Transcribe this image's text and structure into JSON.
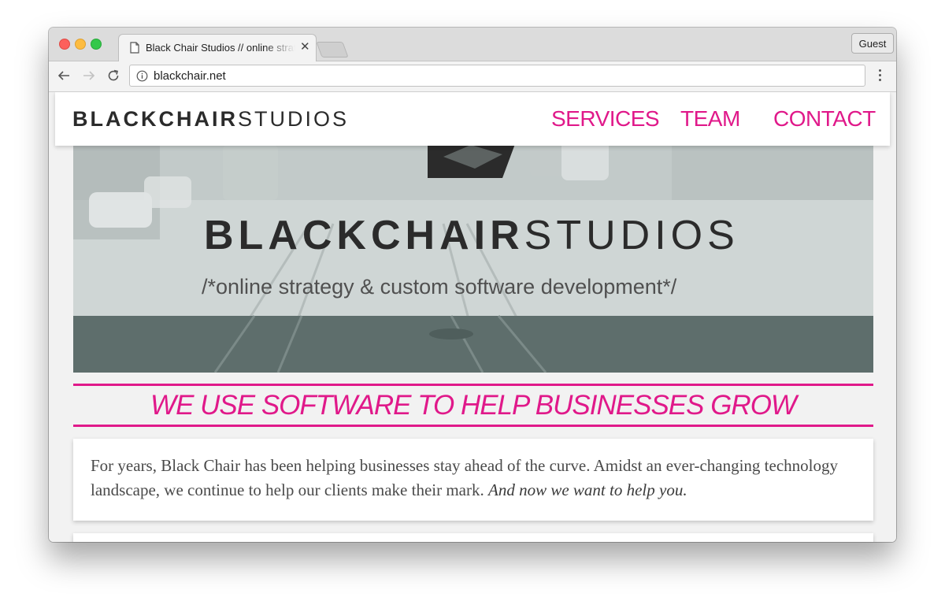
{
  "browser": {
    "tab_title": "Black Chair Studios // online strategy & custom software development",
    "tab_close_icon": "close-icon",
    "guest_label": "Guest",
    "url": "blackchair.net"
  },
  "site": {
    "logo_bold": "BLACKCHAIR",
    "logo_light": "STUDIOS",
    "nav": {
      "services": "SERVICES",
      "team": "TEAM",
      "contact": "CONTACT"
    },
    "hero": {
      "logo_bold": "BLACKCHAIR",
      "logo_light": "STUDIOS",
      "tagline": "/*online strategy & custom software development*/"
    },
    "headline": "WE USE SOFTWARE TO HELP BUSINESSES GROW",
    "intro": {
      "text": "For years, Black Chair has been helping businesses stay ahead of the curve. Amidst an ever-changing technology landscape, we continue to help our clients make their mark.",
      "emphasis": "And now we want to help you."
    }
  },
  "colors": {
    "accent": "#e0198a",
    "logo_dark": "#2b2b2b"
  }
}
